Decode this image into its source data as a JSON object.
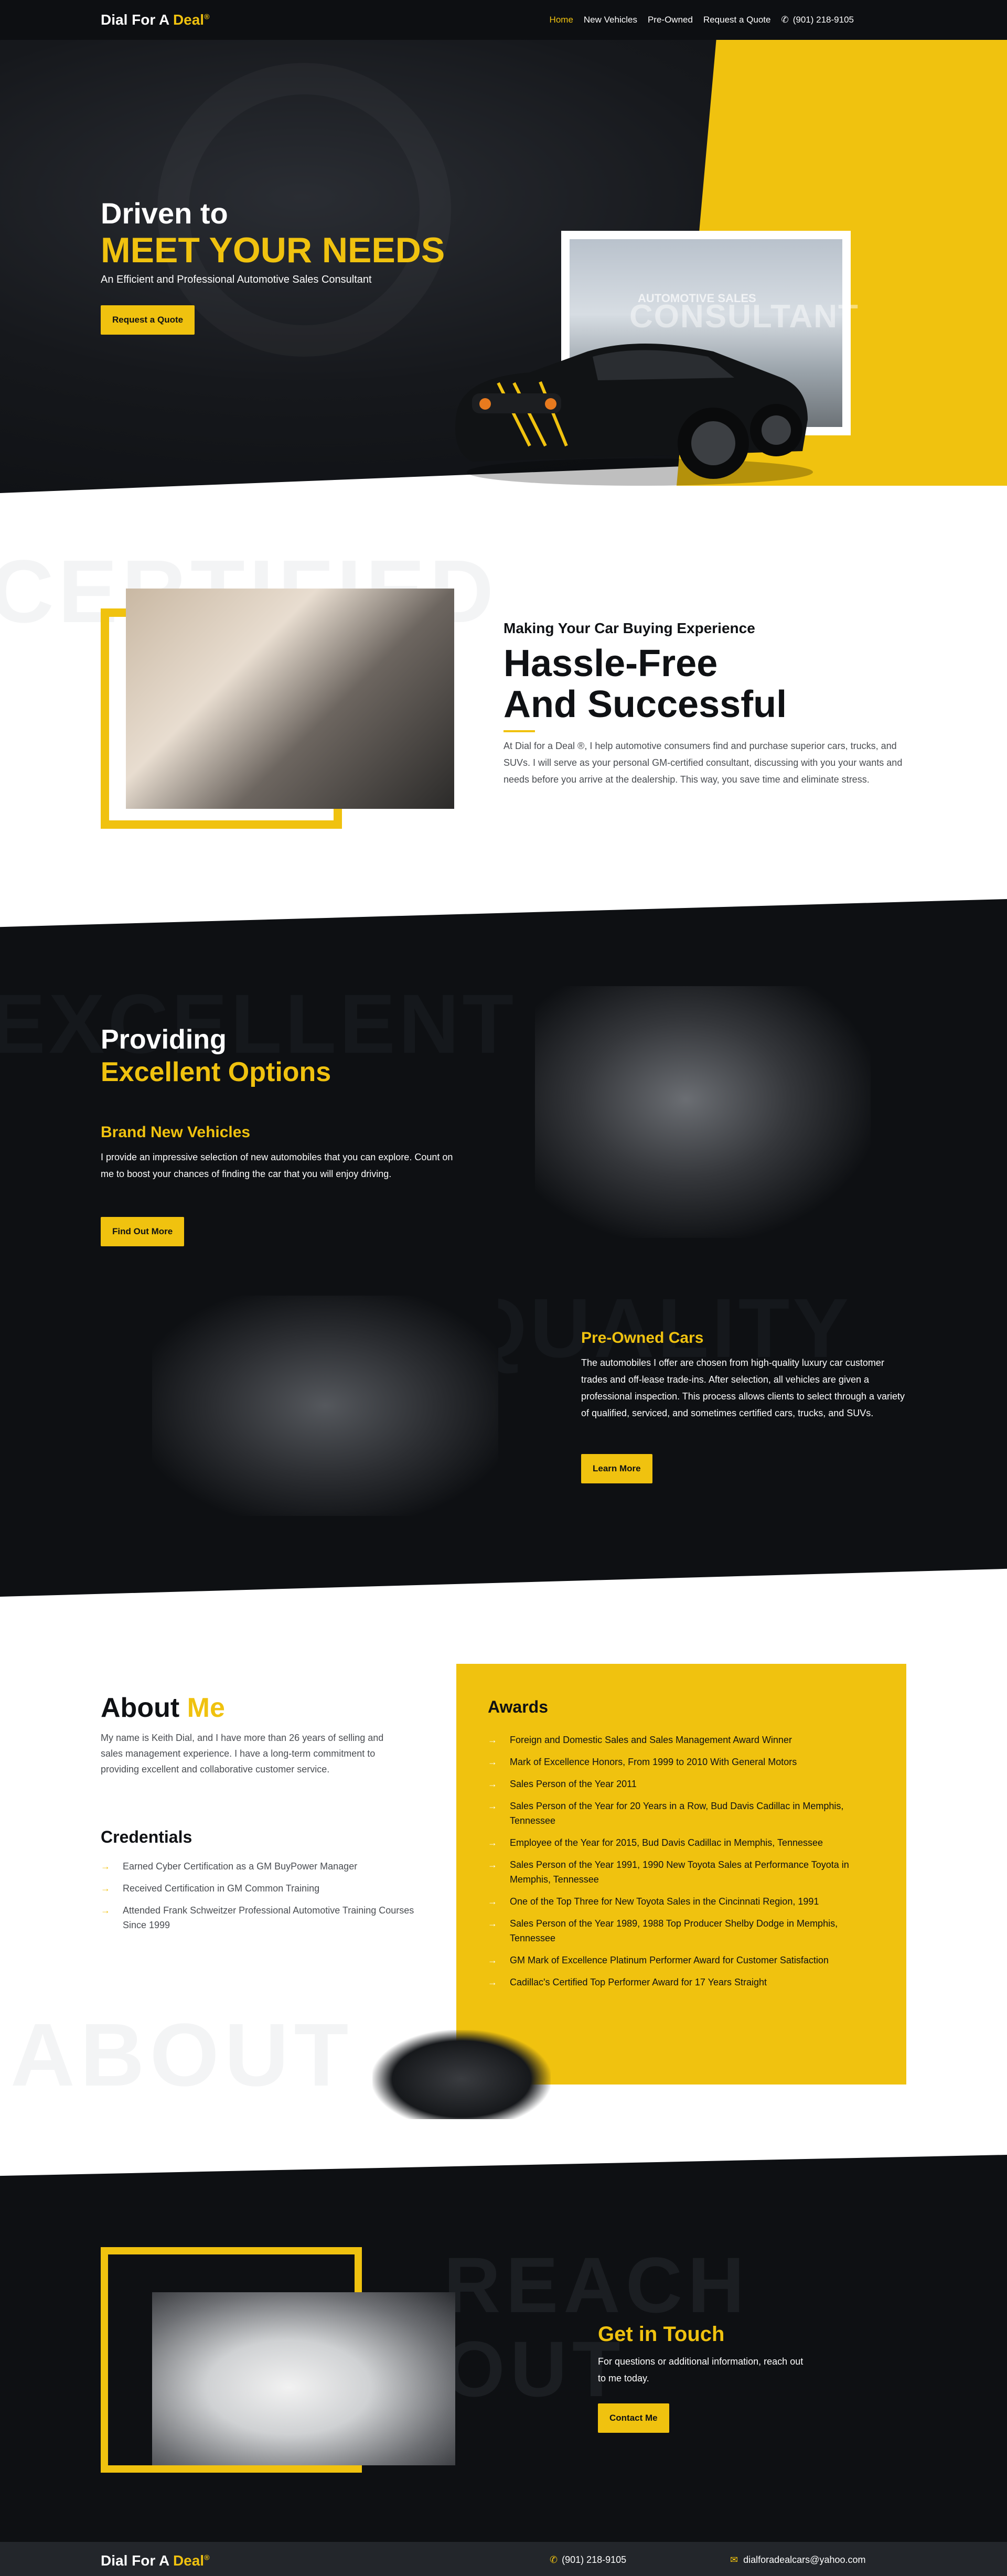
{
  "brand": {
    "name_part1": "Dial For A",
    "name_part2": "Deal",
    "reg": "®"
  },
  "nav": {
    "items": [
      "Home",
      "New Vehicles",
      "Pre-Owned",
      "Request a Quote"
    ],
    "active": "Home",
    "phone": "(901) 218-9105"
  },
  "hero": {
    "title_line1": "Driven to",
    "title_line2": "MEET YOUR NEEDS",
    "subtitle": "An Efficient and Professional Automotive Sales Consultant",
    "cta": "Request a Quote",
    "frame_label1": "AUTOMOTIVE SALES",
    "frame_label2": "CONSULTANT"
  },
  "intro": {
    "bg_word": "CERTIFIED",
    "kicker": "Making Your Car Buying Experience",
    "title_line1": "Hassle-Free",
    "title_line2": "And Successful",
    "body": "At Dial for a Deal ®, I help automotive consumers find and purchase superior cars, trucks, and SUVs. I will serve as your personal GM-certified consultant, discussing with you your wants and needs before you arrive at the dealership. This way, you save time and eliminate stress."
  },
  "options": {
    "bg_word1": "EXCELLENT",
    "bg_word2": "QUALITY",
    "title_line1": "Providing",
    "title_line2": "Excellent Options",
    "new_title": "Brand New Vehicles",
    "new_body": "I provide an impressive selection of new automobiles that you can explore. Count on me to boost your chances of finding the car that you will enjoy driving.",
    "new_cta": "Find Out More",
    "used_title": "Pre-Owned Cars",
    "used_body": "The automobiles I offer are chosen from high-quality luxury car customer trades and off-lease trade-ins. After selection, all vehicles are given a professional inspection. This process allows clients to select through a variety of qualified, serviced, and sometimes certified cars, trucks, and SUVs.",
    "used_cta": "Learn More"
  },
  "about": {
    "bg_word": "ABOUT",
    "title_part1": "About",
    "title_part2": "Me",
    "body": "My name is Keith Dial, and I have more than 26 years of selling and sales management experience. I have a long-term commitment to providing excellent and collaborative customer service.",
    "credentials_title": "Credentials",
    "credentials": [
      "Earned Cyber Certification as a GM BuyPower Manager",
      "Received Certification in GM Common Training",
      "Attended Frank Schweitzer Professional Automotive Training Courses Since 1999"
    ],
    "awards_title": "Awards",
    "awards": [
      "Foreign and Domestic Sales and Sales Management Award Winner",
      "Mark of Excellence Honors, From 1999 to 2010 With General Motors",
      "Sales Person of the Year 2011",
      "Sales Person of the Year for 20 Years in a Row, Bud Davis Cadillac in Memphis, Tennessee",
      "Employee of the Year for 2015, Bud Davis Cadillac in Memphis, Tennessee",
      "Sales Person of the Year 1991, 1990 New Toyota Sales at Performance Toyota in Memphis, Tennessee",
      "One of the Top Three for New Toyota Sales in the Cincinnati Region, 1991",
      "Sales Person of the Year 1989, 1988 Top Producer Shelby Dodge in Memphis, Tennessee",
      "GM Mark of Excellence Platinum Performer Award for Customer Satisfaction",
      "Cadillac's Certified Top Performer Award for 17 Years Straight"
    ]
  },
  "contact": {
    "bg_word1": "REACH",
    "bg_word2": "OUT",
    "title": "Get in Touch",
    "body": "For questions or additional information, reach out to me today.",
    "cta": "Contact Me"
  },
  "footer": {
    "phone": "(901) 218-9105",
    "email": "dialforadealcars@yahoo.com"
  },
  "icons": {
    "phone": "phone-icon",
    "email": "mail-icon",
    "arrow": "arrow-right-icon"
  },
  "colors": {
    "accent": "#f0c20f",
    "dark": "#0e1013"
  }
}
